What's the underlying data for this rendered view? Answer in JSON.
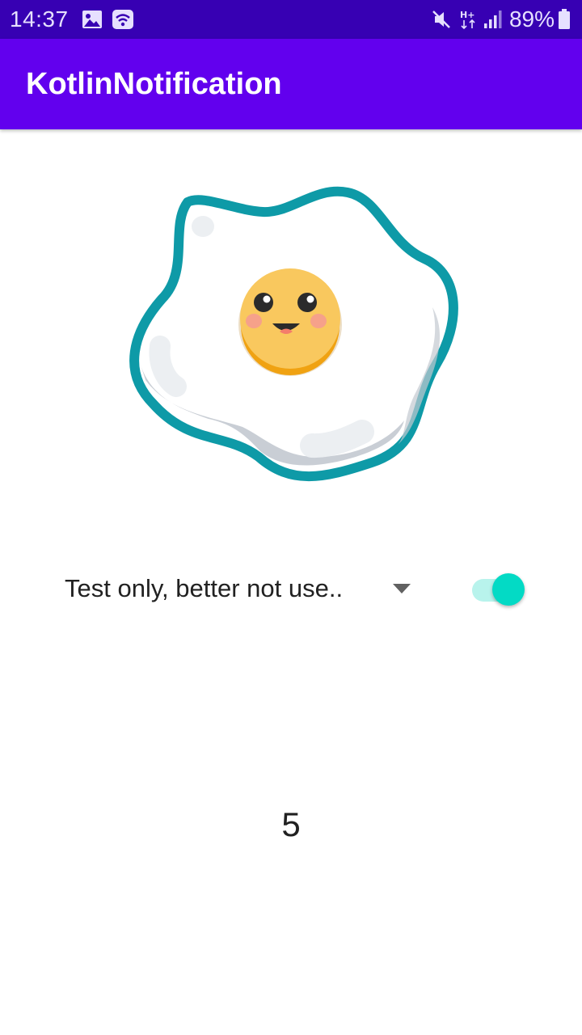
{
  "status_bar": {
    "time": "14:37",
    "battery_percent": "89%",
    "network_type": "H+",
    "icons": [
      "image-icon",
      "wifi-icon",
      "mute-icon",
      "signal-icon",
      "battery-icon"
    ]
  },
  "app_bar": {
    "title": "KotlinNotification",
    "color": "#6200ee"
  },
  "illustration": {
    "icon": "fried-egg-smiley-icon"
  },
  "spinner": {
    "selected": "Test only, better not use..",
    "arrow_icon": "dropdown-arrow-icon"
  },
  "toggle": {
    "state": "on",
    "color": "#03dac5"
  },
  "counter": {
    "value": "5"
  },
  "colors": {
    "status_bar": "#3700b3",
    "primary": "#6200ee",
    "accent": "#03dac5",
    "egg_outline": "#0e9aa7",
    "yolk": "#f9c85e"
  }
}
